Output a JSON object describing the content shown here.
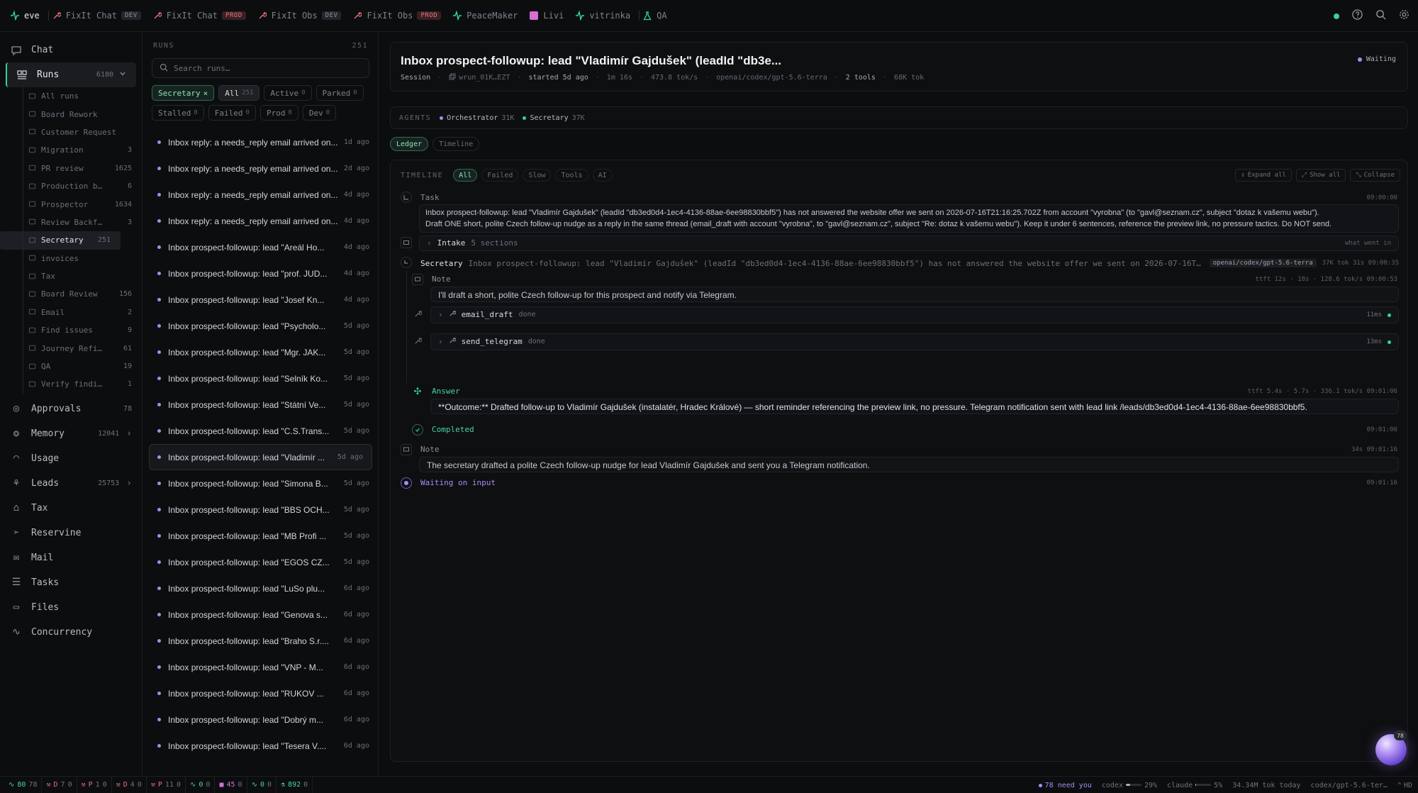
{
  "topbar": {
    "tabs": [
      {
        "label": "eve",
        "icon": "pulse-icon",
        "badge": "",
        "color": "#34d399"
      },
      {
        "label": "FixIt Chat",
        "icon": "wrench-icon",
        "badge": "DEV",
        "color": "#e46f7c"
      },
      {
        "label": "FixIt Chat",
        "icon": "wrench-icon",
        "badge": "PROD",
        "color": "#e46f7c"
      },
      {
        "label": "FixIt Obs",
        "icon": "wrench-icon",
        "badge": "DEV",
        "color": "#e46f7c"
      },
      {
        "label": "FixIt Obs",
        "icon": "wrench-icon",
        "badge": "PROD",
        "color": "#e46f7c"
      },
      {
        "label": "PeaceMaker",
        "icon": "pulse-icon",
        "badge": "",
        "color": "#34d399"
      },
      {
        "label": "Livi",
        "icon": "square-icon",
        "badge": "",
        "color": "#d66fd0"
      },
      {
        "label": "vitrinka",
        "icon": "pulse-icon",
        "badge": "",
        "color": "#34d399"
      },
      {
        "label": "QA",
        "icon": "flask-icon",
        "badge": "",
        "color": "#34d399"
      }
    ]
  },
  "sidebar": {
    "chat": "Chat",
    "runs": {
      "label": "Runs",
      "count": "6180"
    },
    "sub": [
      {
        "label": "All runs",
        "count": ""
      },
      {
        "label": "Board Rework",
        "count": ""
      },
      {
        "label": "Customer Request",
        "count": ""
      },
      {
        "label": "Migration",
        "count": "3"
      },
      {
        "label": "PR review",
        "count": "1625"
      },
      {
        "label": "Production b…",
        "count": "6"
      },
      {
        "label": "Prospector",
        "count": "1634"
      },
      {
        "label": "Review Backf…",
        "count": "3"
      },
      {
        "label": "Secretary",
        "count": "251"
      },
      {
        "label": "invoices",
        "count": ""
      },
      {
        "label": "Tax",
        "count": ""
      },
      {
        "label": "Board Review",
        "count": "156"
      },
      {
        "label": "Email",
        "count": "2"
      },
      {
        "label": "Find issues",
        "count": "9"
      },
      {
        "label": "Journey Refi…",
        "count": "61"
      },
      {
        "label": "QA",
        "count": "19"
      },
      {
        "label": "Verify findi…",
        "count": "1"
      }
    ],
    "bottom": [
      {
        "label": "Approvals",
        "count": "78",
        "icon": "check-circle-icon"
      },
      {
        "label": "Memory",
        "count": "12041",
        "icon": "brain-icon"
      },
      {
        "label": "Usage",
        "count": "",
        "icon": "gauge-icon"
      },
      {
        "label": "Leads",
        "count": "25753",
        "icon": "network-icon"
      },
      {
        "label": "Tax",
        "count": "",
        "icon": "bank-icon"
      },
      {
        "label": "Reservine",
        "count": "",
        "icon": "send-icon"
      },
      {
        "label": "Mail",
        "count": "",
        "icon": "mail-icon"
      },
      {
        "label": "Tasks",
        "count": "",
        "icon": "tasks-icon"
      },
      {
        "label": "Files",
        "count": "",
        "icon": "folder-icon"
      },
      {
        "label": "Concurrency",
        "count": "",
        "icon": "pulse-icon"
      }
    ]
  },
  "runs": {
    "title": "RUNS",
    "count": "251",
    "search_placeholder": "Search runs…",
    "chips": [
      {
        "label": "Secretary",
        "n": "×"
      },
      {
        "label": "All",
        "n": "251"
      },
      {
        "label": "Active",
        "n": "0"
      },
      {
        "label": "Parked",
        "n": "0"
      },
      {
        "label": "Stalled",
        "n": "0"
      },
      {
        "label": "Failed",
        "n": "0"
      },
      {
        "label": "Prod",
        "n": "0"
      },
      {
        "label": "Dev",
        "n": "0"
      }
    ],
    "items": [
      {
        "t": "Inbox reply: a needs_reply email arrived on...",
        "ago": "1d ago"
      },
      {
        "t": "Inbox reply: a needs_reply email arrived on...",
        "ago": "2d ago"
      },
      {
        "t": "Inbox reply: a needs_reply email arrived on...",
        "ago": "4d ago"
      },
      {
        "t": "Inbox reply: a needs_reply email arrived on...",
        "ago": "4d ago"
      },
      {
        "t": "Inbox prospect-followup: lead \"Areál Ho...",
        "ago": "4d ago"
      },
      {
        "t": "Inbox prospect-followup: lead \"prof. JUD...",
        "ago": "4d ago"
      },
      {
        "t": "Inbox prospect-followup: lead \"Josef Kn...",
        "ago": "4d ago"
      },
      {
        "t": "Inbox prospect-followup: lead \"Psycholo...",
        "ago": "5d ago"
      },
      {
        "t": "Inbox prospect-followup: lead \"Mgr. JAK...",
        "ago": "5d ago"
      },
      {
        "t": "Inbox prospect-followup: lead \"Selník Ko...",
        "ago": "5d ago"
      },
      {
        "t": "Inbox prospect-followup: lead \"Státní Ve...",
        "ago": "5d ago"
      },
      {
        "t": "Inbox prospect-followup: lead \"C.S.Trans...",
        "ago": "5d ago"
      },
      {
        "t": "Inbox prospect-followup: lead \"Vladimír ...",
        "ago": "5d ago"
      },
      {
        "t": "Inbox prospect-followup: lead \"Simona B...",
        "ago": "5d ago"
      },
      {
        "t": "Inbox prospect-followup: lead \"BBS OCH...",
        "ago": "5d ago"
      },
      {
        "t": "Inbox prospect-followup: lead \"MB Profi ...",
        "ago": "5d ago"
      },
      {
        "t": "Inbox prospect-followup: lead \"EGOS CZ...",
        "ago": "5d ago"
      },
      {
        "t": "Inbox prospect-followup: lead \"LuSo plu...",
        "ago": "6d ago"
      },
      {
        "t": "Inbox prospect-followup: lead \"Genova s...",
        "ago": "6d ago"
      },
      {
        "t": "Inbox prospect-followup: lead \"Braho S.r....",
        "ago": "6d ago"
      },
      {
        "t": "Inbox prospect-followup: lead \"VNP - M...",
        "ago": "6d ago"
      },
      {
        "t": "Inbox prospect-followup: lead \"RUKOV ...",
        "ago": "6d ago"
      },
      {
        "t": "Inbox prospect-followup: lead \"Dobrý m...",
        "ago": "6d ago"
      },
      {
        "t": "Inbox prospect-followup: lead \"Tesera V....",
        "ago": "6d ago"
      }
    ]
  },
  "main": {
    "title": "Inbox prospect-followup: lead \"Vladimír Gajdušek\" (leadId \"db3e...",
    "session": "Session",
    "run_id": "wrun_01K…EZT",
    "started": "started 5d ago",
    "duration": "1m 16s",
    "rate": "473.8 tok/s",
    "model": "openai/codex/gpt-5.6-terra",
    "tools": "2 tools",
    "tokens": "68K tok",
    "status": "Waiting",
    "agents_label": "AGENTS",
    "agents": [
      {
        "name": "Orchestrator",
        "k": "31K",
        "color": "#a58cf2"
      },
      {
        "name": "Secretary",
        "k": "37K",
        "color": "#34d399"
      }
    ],
    "view_tabs": [
      "Ledger",
      "Timeline"
    ],
    "timeline": {
      "label": "TIMELINE",
      "filters": [
        "All",
        "Failed",
        "Slow",
        "Tools",
        "AI"
      ],
      "actions": [
        "Expand all",
        "Show all",
        "Collapse"
      ],
      "task_label": "Task",
      "task_time": "09:00:00",
      "task_text_1": "Inbox prospect-followup: lead \"Vladimír Gajdušek\" (leadId \"db3ed0d4-1ec4-4136-88ae-6ee98830bbf5\") has not answered the website offer we sent on 2026-07-16T21:16:25.702Z from account \"vyrobna\" (to \"gavl@seznam.cz\", subject \"dotaz k vašemu webu\").",
      "task_text_2": "Draft ONE short, polite Czech follow-up nudge as a reply in the same thread (email_draft with account \"vyrobna\", to \"gavl@seznam.cz\", subject \"Re: dotaz k vašemu webu\"). Keep it under 6 sentences, reference the preview link, no pressure tactics. Do NOT send.",
      "intake_label": "Intake",
      "intake_sections": "5 sections",
      "intake_hint": "what went in",
      "sec_label": "Secretary",
      "sec_text": "Inbox prospect-followup: lead \"Vladimír Gajdušek\" (leadId \"db3ed0d4-1ec4-4136-88ae-6ee98830bbf5\") has not answered the website offer we sent on 2026-07-16T21:16...",
      "sec_model": "openai/codex/gpt-5.6-terra",
      "sec_meta": "37K tok 31s 09:00:35",
      "note1_label": "Note",
      "note1_meta": "ttft 12s · 18s · 128.6 tok/s 09:00:53",
      "note1_text": "I'll draft a short, polite Czech follow-up for this prospect and notify via Telegram.",
      "tool1": {
        "name": "email_draft",
        "status": "done",
        "time": "11ms"
      },
      "tool2": {
        "name": "send_telegram",
        "status": "done",
        "time": "13ms"
      },
      "answer_label": "Answer",
      "answer_meta": "ttft 5.4s · 5.7s · 336.1 tok/s 09:01:06",
      "answer_text": "**Outcome:** Drafted follow-up to Vladimír Gajdušek (instalatér, Hradec Králové) — short reminder referencing the preview link, no pressure. Telegram notification sent with lead link /leads/db3ed0d4-1ec4-4136-88ae-6ee98830bbf5.",
      "completed_label": "Completed",
      "completed_time": "09:01:06",
      "note2_label": "Note",
      "note2_meta": "34s 09:01:16",
      "note2_text": "The secretary drafted a polite Czech follow-up nudge for lead Vladimír Gajdušek and sent you a Telegram notification.",
      "waiting_label": "Waiting on input",
      "waiting_time": "09:01:16"
    }
  },
  "statusbar": {
    "items": [
      {
        "icon": "pulse-icon",
        "a": "80",
        "b": "78",
        "color": "#4ad3a0"
      },
      {
        "icon": "wrench-icon",
        "a": "D",
        "b": "7",
        "c": "0",
        "color": "#e46f7c"
      },
      {
        "icon": "wrench-icon",
        "a": "P",
        "b": "1",
        "c": "0",
        "color": "#e46f7c"
      },
      {
        "icon": "wrench-icon",
        "a": "D",
        "b": "4",
        "c": "0",
        "color": "#e46f7c"
      },
      {
        "icon": "wrench-icon",
        "a": "P",
        "b": "11",
        "c": "0",
        "color": "#e46f7c"
      },
      {
        "icon": "pulse-icon",
        "a": "0",
        "b": "0",
        "color": "#4ad3a0"
      },
      {
        "icon": "square-icon",
        "a": "45",
        "b": "0",
        "color": "#d66fd0"
      },
      {
        "icon": "pulse-icon",
        "a": "0",
        "b": "0",
        "color": "#4ad3a0"
      },
      {
        "icon": "flask-icon",
        "a": "892",
        "b": "0",
        "color": "#4ad3a0"
      }
    ],
    "need_you": "78 need you",
    "codex_label": "codex",
    "codex_pct": "29%",
    "codex_fill": 0.29,
    "claude_label": "claude",
    "claude_pct": "5%",
    "claude_fill": 0.05,
    "tok_today": "34.34M tok today",
    "model": "codex/gpt-5.6-ter…",
    "hd": "HD",
    "orb_count": "78"
  }
}
